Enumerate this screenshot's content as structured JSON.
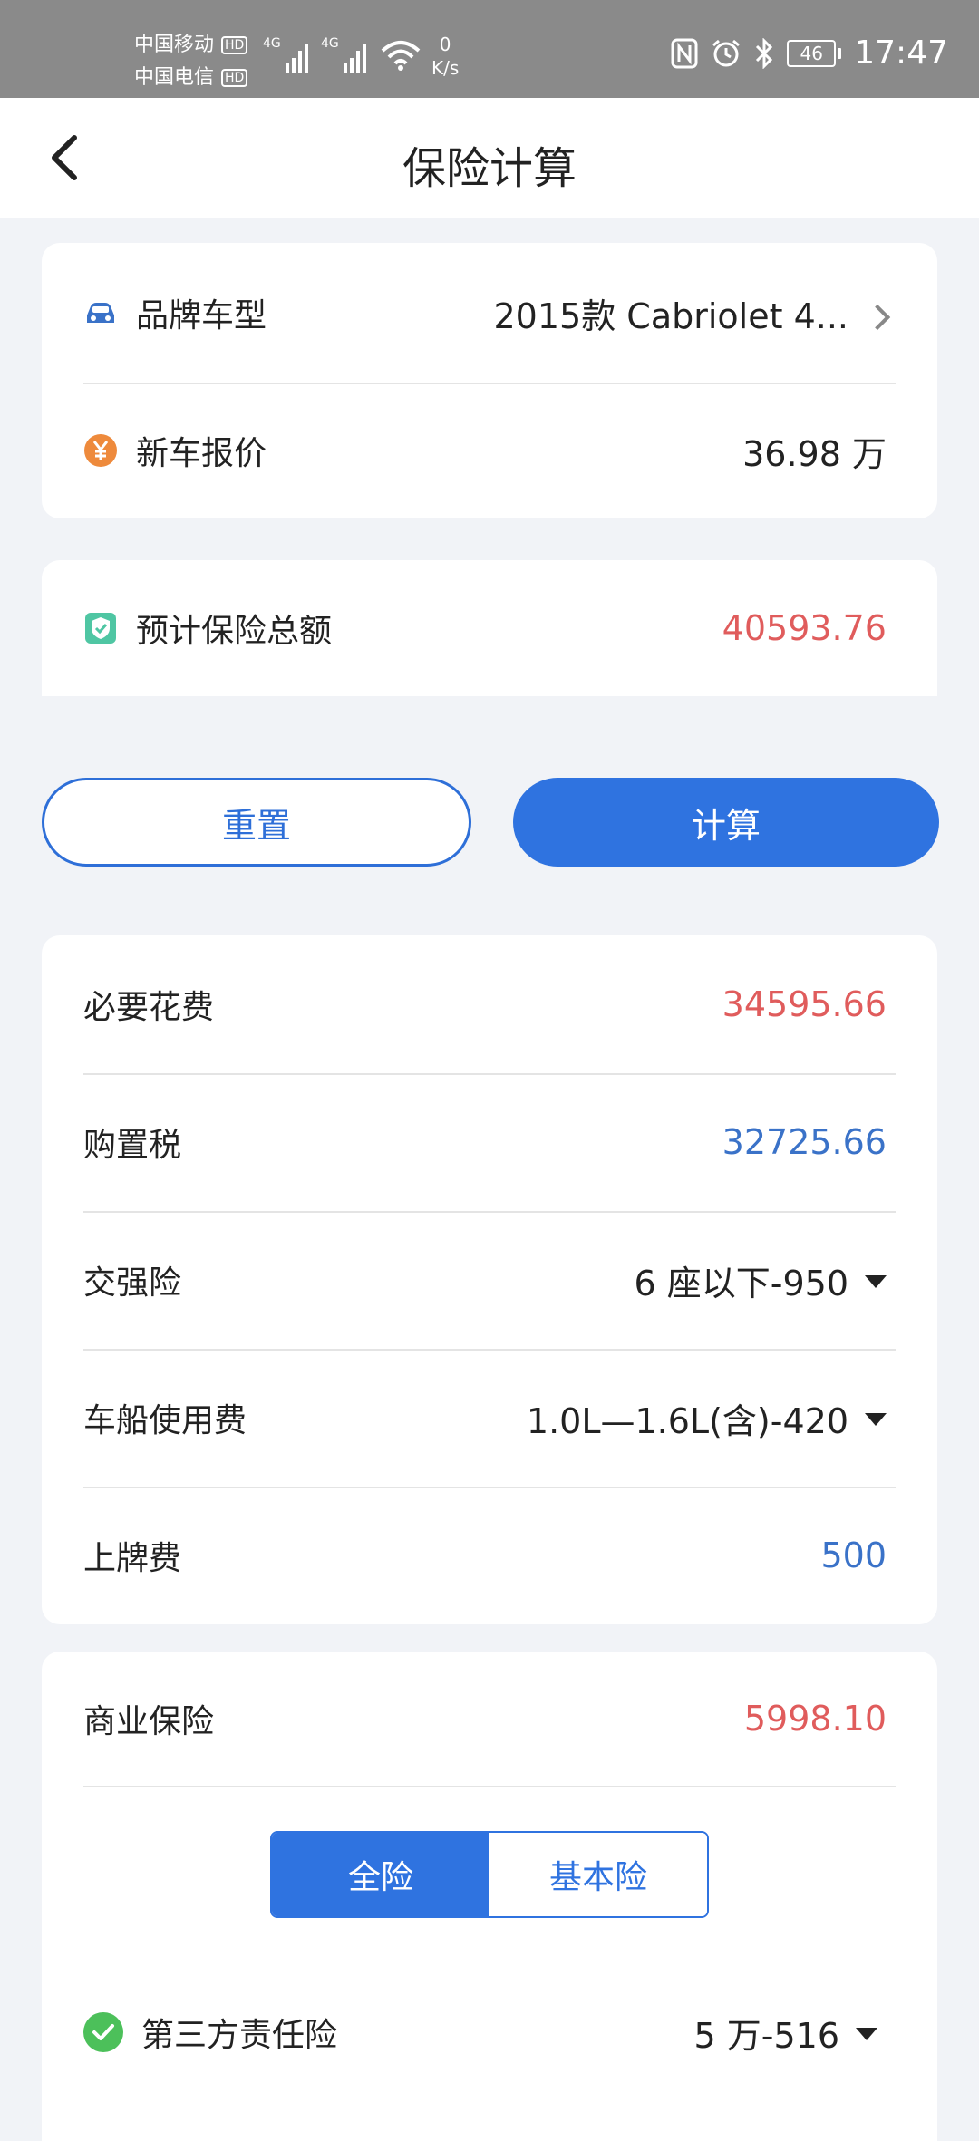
{
  "status_bar": {
    "carrier1": "中国移动",
    "carrier2": "中国电信",
    "hd": "HD",
    "network": "4G",
    "speed_value": "0",
    "speed_unit": "K/s",
    "battery": "46",
    "time": "17:47"
  },
  "header": {
    "title": "保险计算"
  },
  "car_card": {
    "brand_label": "品牌车型",
    "brand_value": "2015款 Cabriolet 4...",
    "price_label": "新车报价",
    "price_value": "36.98 万"
  },
  "total_card": {
    "label": "预计保险总额",
    "value": "40593.76"
  },
  "buttons": {
    "reset": "重置",
    "calculate": "计算"
  },
  "required_card": {
    "title": "必要花费",
    "title_value": "34595.66",
    "rows": [
      {
        "label": "购置税",
        "value": "32725.66"
      },
      {
        "label": "交强险",
        "value": "6 座以下-950"
      },
      {
        "label": "车船使用费",
        "value": "1.0L—1.6L(含)-420"
      },
      {
        "label": "上牌费",
        "value": "500"
      }
    ]
  },
  "commercial_card": {
    "title": "商业保险",
    "title_value": "5998.10",
    "segments": [
      "全险",
      "基本险"
    ],
    "selected_segment": "全险",
    "third_party_label": "第三方责任险",
    "third_party_value": "5 万-516"
  },
  "colors": {
    "accent": "#2f73e0",
    "red_value": "#e05c5c",
    "blue_value": "#3a72c8",
    "check_green": "#4cc05a"
  }
}
